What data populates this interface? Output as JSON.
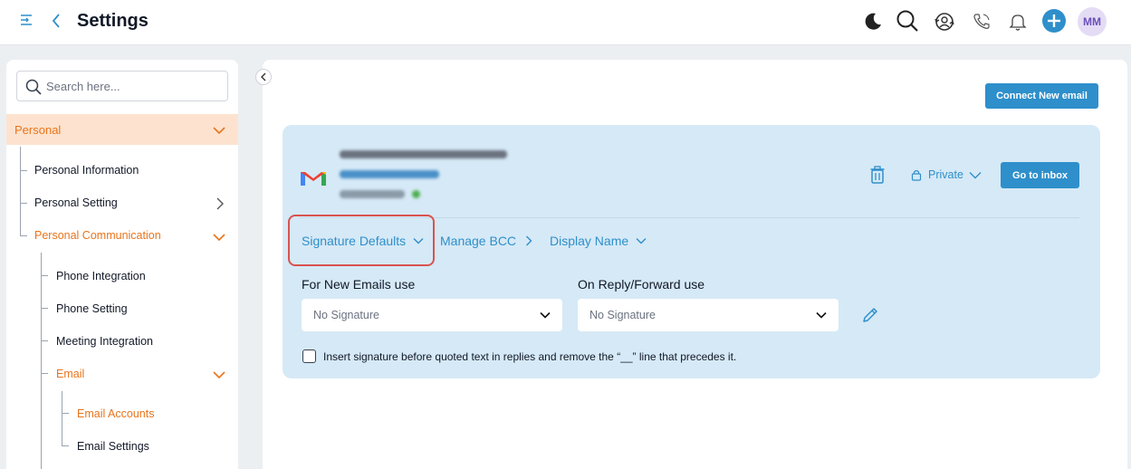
{
  "header": {
    "title": "Settings",
    "avatar_initials": "MM",
    "icons": [
      "moon-icon",
      "search-icon",
      "sync-icon",
      "phone-icon",
      "bell-icon",
      "plus-icon"
    ]
  },
  "sidebar": {
    "search_placeholder": "Search here...",
    "section": "Personal",
    "items": [
      {
        "label": "Personal Information"
      },
      {
        "label": "Personal Setting"
      },
      {
        "label": "Personal Communication"
      },
      {
        "label": "Phone Integration"
      },
      {
        "label": "Phone Setting"
      },
      {
        "label": "Meeting Integration"
      },
      {
        "label": "Email"
      },
      {
        "label": "Email Accounts"
      },
      {
        "label": "Email Settings"
      }
    ]
  },
  "main": {
    "connect_button": "Connect New email",
    "account": {
      "privacy": "Private",
      "go_to_inbox": "Go to inbox"
    },
    "tabs": [
      {
        "label": "Signature Defaults"
      },
      {
        "label": "Manage BCC"
      },
      {
        "label": "Display Name"
      }
    ],
    "new_emails_label": "For New Emails use",
    "new_emails_value": "No Signature",
    "reply_label": "On Reply/Forward use",
    "reply_value": "No Signature",
    "checkbox_label": "Insert signature before quoted text in replies and remove the “__” line that precedes it."
  },
  "colors": {
    "accent": "#2e8fcb",
    "orange": "#e8741b",
    "highlight": "#d9534f",
    "card_bg": "#d6e9f6"
  }
}
